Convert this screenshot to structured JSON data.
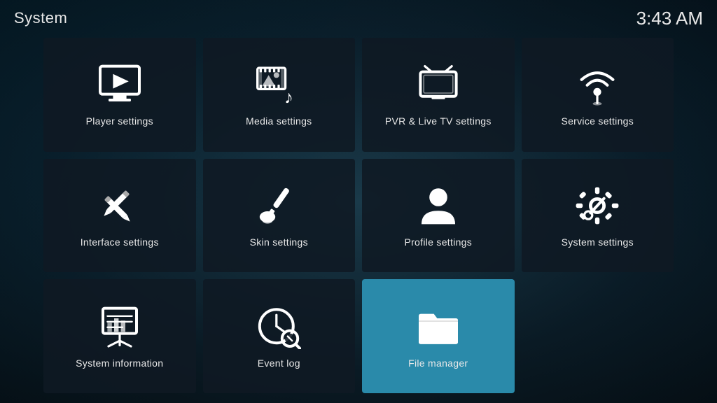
{
  "header": {
    "title": "System",
    "time": "3:43 AM"
  },
  "tiles": [
    {
      "id": "player-settings",
      "label": "Player settings",
      "icon": "player",
      "active": false
    },
    {
      "id": "media-settings",
      "label": "Media settings",
      "icon": "media",
      "active": false
    },
    {
      "id": "pvr-settings",
      "label": "PVR & Live TV settings",
      "icon": "pvr",
      "active": false
    },
    {
      "id": "service-settings",
      "label": "Service settings",
      "icon": "service",
      "active": false
    },
    {
      "id": "interface-settings",
      "label": "Interface settings",
      "icon": "interface",
      "active": false
    },
    {
      "id": "skin-settings",
      "label": "Skin settings",
      "icon": "skin",
      "active": false
    },
    {
      "id": "profile-settings",
      "label": "Profile settings",
      "icon": "profile",
      "active": false
    },
    {
      "id": "system-settings",
      "label": "System settings",
      "icon": "systemsettings",
      "active": false
    },
    {
      "id": "system-information",
      "label": "System information",
      "icon": "sysinfo",
      "active": false
    },
    {
      "id": "event-log",
      "label": "Event log",
      "icon": "eventlog",
      "active": false
    },
    {
      "id": "file-manager",
      "label": "File manager",
      "icon": "filemanager",
      "active": true
    }
  ]
}
